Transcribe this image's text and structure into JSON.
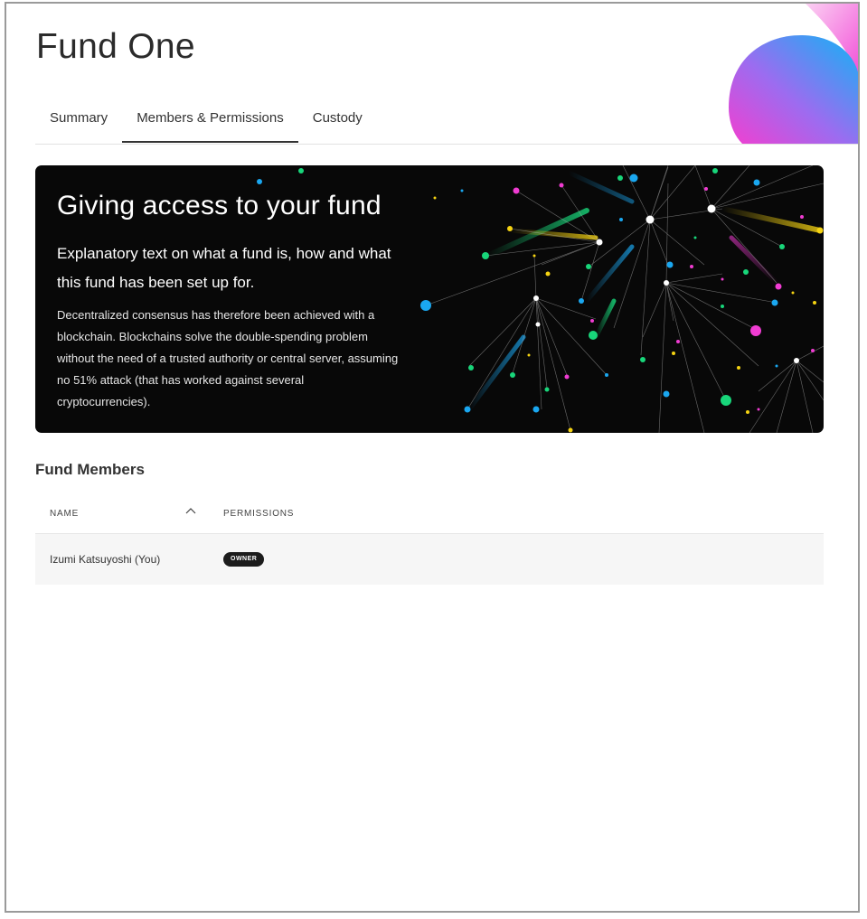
{
  "page": {
    "title": "Fund One"
  },
  "tabs": [
    {
      "label": "Summary",
      "active": false
    },
    {
      "label": "Members & Permissions",
      "active": true
    },
    {
      "label": "Custody",
      "active": false
    }
  ],
  "banner": {
    "heading": "Giving access to your fund",
    "lead": "Explanatory text on what a fund is, how and what this fund has been set up for.",
    "body": "Decentralized consensus has therefore been achieved with a blockchain. Blockchains solve the double-spending problem without the need of a trusted authority or central server, assuming no 51% attack (that has worked against several cryptocurrencies)."
  },
  "members": {
    "title": "Fund Members",
    "columns": {
      "name": "NAME",
      "permissions": "PERMISSIONS"
    },
    "sort_icon": "chevron-up-icon",
    "rows": [
      {
        "name": "Izumi Katsuyoshi (You)",
        "permission": "OWNER"
      }
    ]
  },
  "colors": {
    "banner_bg": "#080808",
    "accent_blue": "#1aa7f0",
    "accent_pink": "#f03cd2",
    "accent_green": "#18d67a",
    "accent_yellow": "#f5d312"
  }
}
